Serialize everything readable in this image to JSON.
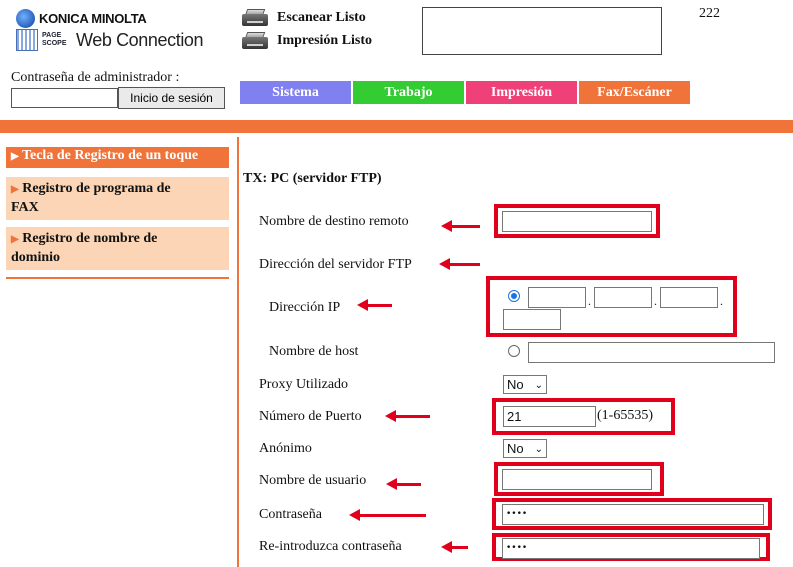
{
  "header": {
    "brand": "KONICA MINOLTA",
    "pagescope_line1": "PAGE",
    "pagescope_line2": "SCOPE",
    "product": "Web Connection",
    "status_scan": "Escanear Listo",
    "status_print": "Impresión Listo",
    "counter": "222"
  },
  "login": {
    "label": "Contraseña de administrador :",
    "button": "Inicio de sesión"
  },
  "tabs": [
    {
      "label": "Sistema",
      "color": "#8080f0"
    },
    {
      "label": "Trabajo",
      "color": "#33cc33"
    },
    {
      "label": "Impresión",
      "color": "#f0407a"
    },
    {
      "label": "Fax/Escáner",
      "color": "#f0733a"
    }
  ],
  "sidebar": {
    "active": "Tecla de Registro de un toque",
    "items": [
      {
        "line1": "Registro de programa de",
        "line2": "FAX"
      },
      {
        "line1": "Registro de nombre de",
        "line2": "dominio"
      }
    ]
  },
  "form": {
    "title": "TX: PC (servidor FTP)",
    "remote_name_label": "Nombre de destino remoto",
    "remote_name_value": "",
    "ftp_server_label": "Dirección del servidor FTP",
    "ip_label": "Dirección IP",
    "ip_sep": ".",
    "host_label": "Nombre de host",
    "proxy_label": "Proxy Utilizado",
    "proxy_value": "No",
    "port_label": "Número de Puerto",
    "port_value": "21",
    "port_range": "(1-65535)",
    "anon_label": "Anónimo",
    "anon_value": "No",
    "user_label": "Nombre de usuario",
    "user_value": "",
    "pass_label": "Contraseña",
    "pass_value": "••••",
    "repass_label": "Re-introduzca contraseña",
    "repass_value": "••••"
  },
  "icons": {
    "printer": "printer-icon",
    "dropdown": "chevron-down-icon",
    "bullet": "triangle-right-icon",
    "arrow": "arrow-left-icon"
  },
  "colors": {
    "accent_orange": "#f0733a",
    "sidebar_item_bg": "#fbd5b5",
    "annotation_red": "#e0001b"
  }
}
